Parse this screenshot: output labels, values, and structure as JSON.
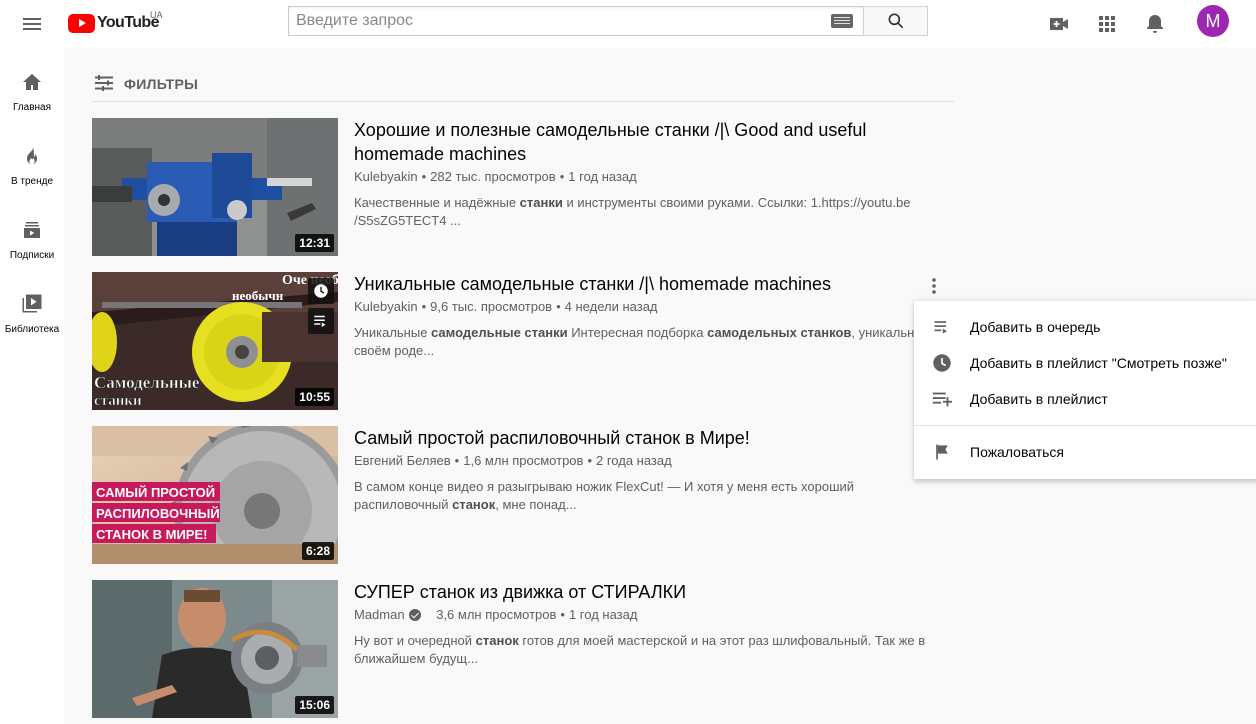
{
  "masthead": {
    "logo_text": "YouTube",
    "country_code": "UA",
    "search_placeholder": "Введите запрос",
    "search_value": "",
    "avatar_letter": "M",
    "avatar_color": "#9c27b0",
    "icons": [
      "menu-icon",
      "keyboard-icon",
      "search-icon",
      "video-camera-add-icon",
      "apps-grid-icon",
      "bell-icon"
    ]
  },
  "guide": {
    "items": [
      {
        "label": "Главная",
        "icon": "home-icon"
      },
      {
        "label": "В тренде",
        "icon": "flame-icon"
      },
      {
        "label": "Подписки",
        "icon": "subscriptions-icon"
      },
      {
        "label": "Библиотека",
        "icon": "library-icon"
      }
    ]
  },
  "filters": {
    "label": "ФИЛЬТРЫ",
    "icon": "filter-sliders-icon"
  },
  "results": [
    {
      "title": "Хорошие и полезные самодельные станки /|\\ Good and useful homemade machines",
      "channel": "Kulebyakin",
      "views": "282 тыс. просмотров",
      "age": "1 год назад",
      "duration": "12:31",
      "desc_parts": [
        "Качественные и надёжные ",
        "станки",
        " и инструменты своими руками. Ссылки: 1.https://youtu.be /S5sZG5TECT4 ..."
      ]
    },
    {
      "title": "Уникальные самодельные станки /|\\ homemade machines",
      "channel": "Kulebyakin",
      "views": "9,6 тыс. просмотров",
      "age": "4 недели назад",
      "duration": "10:55",
      "thumb_text_top": "Оче необычн",
      "thumb_text_bottom": "Самодельные станки",
      "desc_parts": [
        "Уникальные ",
        "самодельные станки",
        " Интересная подборка ",
        "самодельных станков",
        ", уникальны своём роде..."
      ]
    },
    {
      "title": "Самый простой распиловочный станок в Мире!",
      "channel": "Евгений Беляев",
      "views": "1,6 млн просмотров",
      "age": "2 года назад",
      "duration": "6:28",
      "thumb_lines": [
        "САМЫЙ ПРОСТОЙ",
        "РАСПИЛОВОЧНЫЙ",
        "СТАНОК В МИРЕ!"
      ],
      "desc_parts": [
        "В самом конце видео я разыгрываю ножик FlexCut! — И хотя у меня есть хороший распиловочный ",
        "станок",
        ", мне понад..."
      ]
    },
    {
      "title": "СУПЕР станок из движка от СТИРАЛКИ",
      "channel": "Madman",
      "verified": true,
      "views": "3,6 млн просмотров",
      "age": "1 год назад",
      "duration": "15:06",
      "desc_parts": [
        "Ну вот и очередной ",
        "станок",
        " готов для моей мастерской и на этот раз шлифовальный. Так же в ближайшем будущ..."
      ]
    }
  ],
  "context_menu": {
    "items": [
      {
        "label": "Добавить в очередь",
        "icon": "add-to-queue-icon"
      },
      {
        "label": "Добавить в плейлист \"Смотреть позже\"",
        "icon": "clock-icon"
      },
      {
        "label": "Добавить в плейлист",
        "icon": "playlist-add-icon"
      },
      {
        "label": "Пожаловаться",
        "icon": "flag-icon"
      }
    ]
  },
  "colors": {
    "brand_red": "#ff0000",
    "text_primary": "#030303",
    "text_secondary": "#606060",
    "background": "#f9f9f9"
  }
}
